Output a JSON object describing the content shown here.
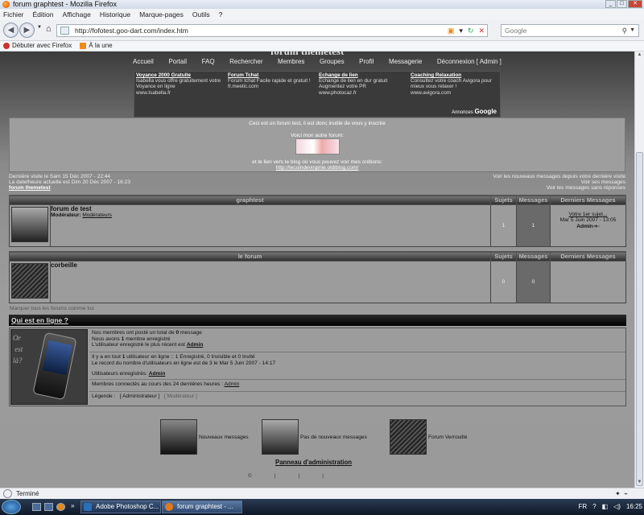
{
  "window": {
    "title": "forum graphtest - Mozilla Firefox"
  },
  "menu": [
    "Fichier",
    "Édition",
    "Affichage",
    "Historique",
    "Marque-pages",
    "Outils",
    "?"
  ],
  "nav": {
    "url": "http://fofotest.goo-dart.com/index.htm",
    "search_placeholder": "Google"
  },
  "bookmarks": [
    "Débuter avec Firefox",
    "À la une"
  ],
  "page": {
    "forum_title": "forum themetest",
    "nav_links": [
      "Accueil",
      "Portail",
      "FAQ",
      "Rechercher",
      "Membres",
      "Groupes",
      "Profil",
      "Messagerie",
      "Déconnexion [ Admin ]"
    ],
    "ads": [
      {
        "title": "Voyance 2000 Gratuite",
        "text": "Isabella vous offre gratuitement votre Voyance en ligne",
        "url": "www.Isabella.fr"
      },
      {
        "title": "Forum Tchat",
        "text": "Forum tchat Facile rapide et gratuit !",
        "url": "fr.meetic.com"
      },
      {
        "title": "Echange de lien",
        "text": "Echange de lien en dur gratuit Augmentez votre PR",
        "url": "www.photocaz.fr"
      },
      {
        "title": "Coaching Relaxation",
        "text": "Consultez votre coach Avigora pour mieux vous relaxer !",
        "url": "www.avigora.com"
      }
    ],
    "ads_by": "Annonces",
    "ads_google": "Google",
    "welcome": {
      "line1": "Ceci est un forum test, il est donc inutile de vous y inscrire",
      "line2": "Voici mon autre forum:",
      "line3": "et le lien vers le blog où vous pouvez voir mes crétions:",
      "link": "http://lecoindevirginie.oldiblog.com/"
    },
    "visits": {
      "last_visit": "Dernière visite le Sam 15 Déc 2007 - 22:44",
      "current_date": "La date/heure actuelle est Dim 20 Déc 2007 - 16:23",
      "breadcrumb": "forum themetest",
      "link_new": "Voir les nouveaux messages depuis votre dernière visite",
      "link_mine": "Voir ses messages",
      "link_unanswered": "Voir les messages sans réponses"
    },
    "col_sujets": "Sujets",
    "col_messages": "Messages",
    "col_last": "Derniers Messages",
    "categories": [
      {
        "name": "graphtest",
        "forum": "forum de test",
        "moderator_label": "Modérateur:",
        "moderator": "Modérateurs",
        "topics": "1",
        "posts": "1",
        "last_title": "Votre 1er sujet...",
        "last_date": "Mar 5 Juin 2007 - 13:05",
        "last_user": "Admin"
      },
      {
        "name": "le forum",
        "forum": "corbeille",
        "topics": "0",
        "posts": "0"
      }
    ],
    "mark_read": "Marquer tous les forums comme lus",
    "who": {
      "heading": "Qui est en ligne ?",
      "phone_text": [
        "Or",
        "est",
        "là?"
      ],
      "stats_pre": "Nos membres ont posté un total de",
      "stats_count": "0",
      "stats_post": "message",
      "members_pre": "Nous avons",
      "members_count": "1",
      "members_post": "membre enregistré",
      "latest_pre": "L'utilisateur enregistré le plus récent est",
      "latest_user": "Admin",
      "online_pre": "Il y a en tout",
      "online_count": "1",
      "online_post": "utilisateur en ligne :: 1 Enregistré, 0 Invisible et 0 Invité",
      "record": "Le record du nombre d'utilisateurs en ligne est de 3 le Mar 5 Juin 2007 - 14:17",
      "registered_label": "Utilisateurs enregistrés:",
      "registered_user": "Admin",
      "last24_label": "Membres connectés au cours des 24 dernières heures :",
      "last24_user": "Admin",
      "legend_label": "Légende :",
      "legend_admin": "[ Administrateur ]",
      "legend_mod": "[ Modérateur ]"
    },
    "icons_legend": [
      "Nouveaux messages",
      "Pas de nouveaux messages",
      "Forum Verrouillé"
    ],
    "admin_panel": "Panneau d'administration",
    "footer": [
      "©",
      "|",
      "|",
      "|"
    ]
  },
  "status": {
    "text": "Terminé"
  },
  "taskbar": {
    "tasks": [
      "Adobe Photoshop C...",
      "forum graphtest - ..."
    ],
    "lang": "FR",
    "time": "16:25"
  }
}
